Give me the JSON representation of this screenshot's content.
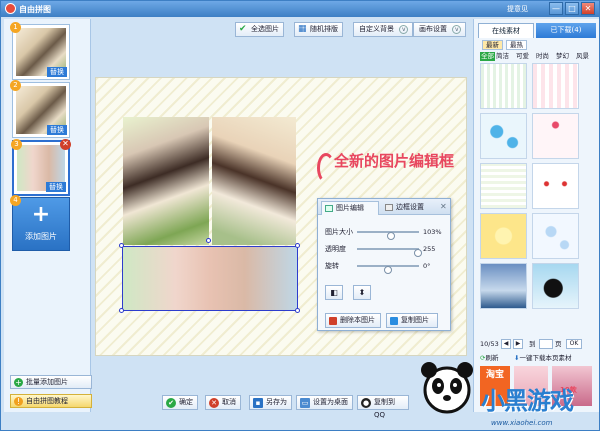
{
  "window": {
    "title": "自由拼图",
    "feedback": "提意见",
    "min": "—",
    "max": "□",
    "close": "✕"
  },
  "left": {
    "thumbs": [
      {
        "num": "1",
        "tag": "替换"
      },
      {
        "num": "2",
        "tag": "替换"
      },
      {
        "num": "3",
        "tag": "替换",
        "del": "✕"
      }
    ],
    "add": {
      "num": "4",
      "plus": "+",
      "label": "添加图片"
    },
    "batch_add": "批量添加图片",
    "tutorial": "自由拼图教程"
  },
  "toolbar": {
    "select_all": "全选图片",
    "random": "随机排版",
    "custom_bg": "自定义背景",
    "canvas_settings": "画布设置",
    "dd": "v"
  },
  "headline": "全新的图片编辑框",
  "dialog": {
    "tab_edit": "图片编辑",
    "tab_border": "边框设置",
    "close": "✕",
    "size_label": "图片大小",
    "size_val": "103%",
    "size_frac": 0.55,
    "opacity_label": "透明度",
    "opacity_val": "255",
    "opacity_frac": 0.98,
    "rotate_label": "旋转",
    "rotate_val": "0°",
    "rotate_frac": 0.5,
    "flip_h": "◧",
    "flip_v": "⬍",
    "delete": "删除本图片",
    "copy": "复制图片"
  },
  "bottom": {
    "ok": "确定",
    "cancel": "取消",
    "save_as": "另存为",
    "set_desktop": "设置为桌面",
    "copy_qq": "复制到QQ"
  },
  "right": {
    "tab_online": "在线素材",
    "tab_downloaded": "已下载(4)",
    "chips": [
      "最新",
      "最热"
    ],
    "cats": [
      "全部",
      "简洁",
      "可爱",
      "时尚",
      "梦幻",
      "风景"
    ],
    "page": "10/53",
    "prev": "◀",
    "next": "▶",
    "goto": "到",
    "page_unit": "页",
    "ok": "OK",
    "refresh": "刷新",
    "download_page": "一键下载本页素材",
    "ad_text": "淘宝",
    "price": "10款"
  },
  "brand": {
    "name": "小黑游戏",
    "site": "www.xiaohei.com"
  }
}
